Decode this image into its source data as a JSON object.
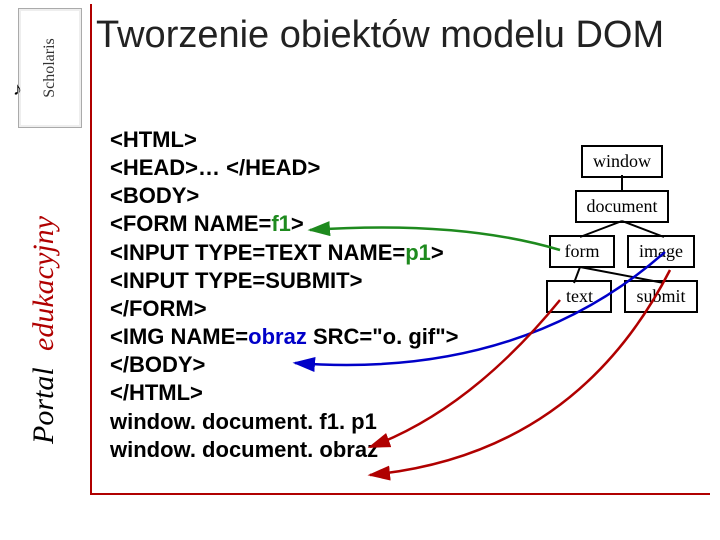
{
  "logo": {
    "text": "Scholaris",
    "symbol": "♪"
  },
  "title": "Tworzenie obiektów modelu DOM",
  "sidebar": {
    "word1": "Portal",
    "word2": "edukacyjny"
  },
  "code": {
    "l1": "<HTML>",
    "l2a": "<HEAD>… </HEAD>",
    "l3": "<BODY>",
    "l4a": "<FORM NAME=",
    "l4b": "f1",
    "l4c": ">",
    "l5a": "<INPUT TYPE=TEXT NAME=",
    "l5b": "p1",
    "l5c": ">",
    "l6": "<INPUT TYPE=SUBMIT>",
    "l7": "</FORM>",
    "l8a": "<IMG NAME=",
    "l8b": "obraz",
    "l8c": " SRC=\"o. gif\">",
    "l9": "</BODY>",
    "l10": "</HTML>",
    "l11": "window. document. f1. p1",
    "l12": "window. document. obraz"
  },
  "tree": {
    "window": "window",
    "document": "document",
    "form": "form",
    "image": "image",
    "text": "text",
    "submit": "submit"
  }
}
